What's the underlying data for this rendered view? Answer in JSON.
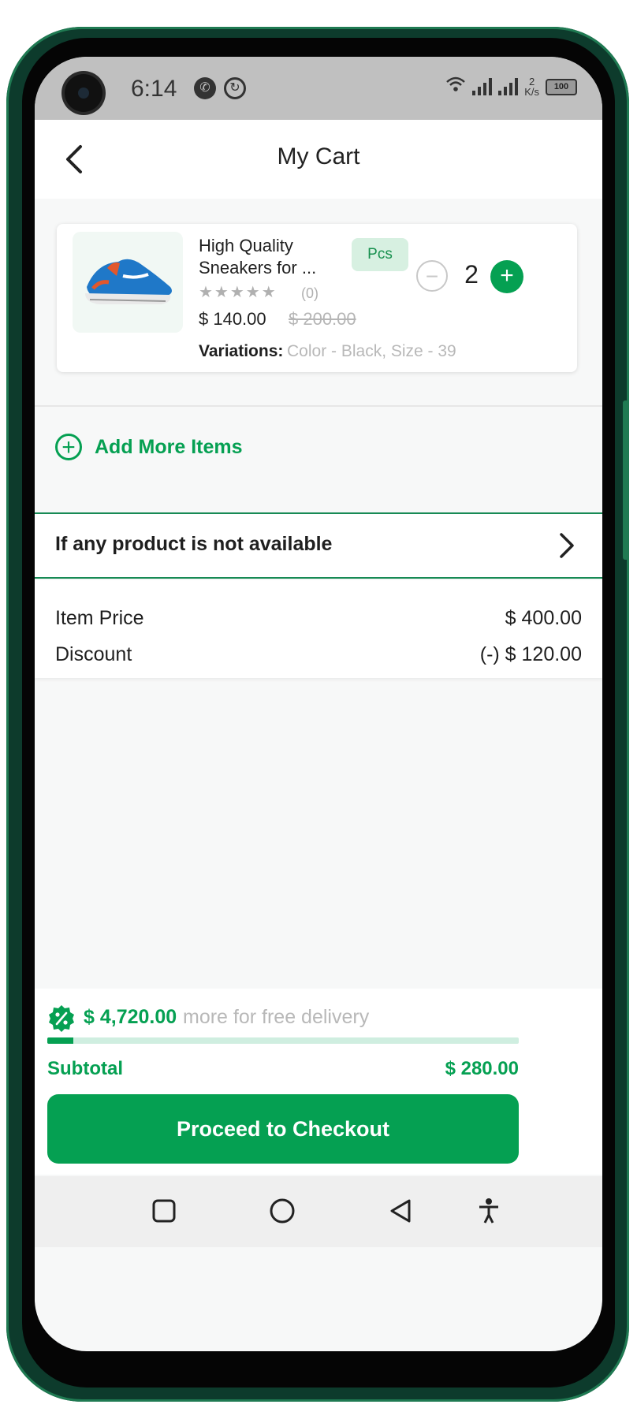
{
  "status_bar": {
    "time": "6:14",
    "icons": [
      "whatsapp-icon",
      "sync-icon",
      "wifi-icon",
      "signal-icon",
      "signal-icon"
    ],
    "net_speed_value": "2",
    "net_speed_unit": "K/s",
    "battery": "100"
  },
  "header": {
    "title": "My Cart",
    "back_icon": "chevron-left-icon"
  },
  "cart_item": {
    "name": "High Quality Sneakers for ...",
    "rating_stars": "★★★★★",
    "rating_count": "(0)",
    "price": "$ 140.00",
    "original_price": "$ 200.00",
    "unit": "Pcs",
    "quantity": "2",
    "variations_label": "Variations:",
    "variations_value": "Color - Black,  Size - 39"
  },
  "add_more": {
    "label": "Add More Items",
    "icon": "plus-circle-icon"
  },
  "availability": {
    "label": "If any product is not available",
    "icon": "chevron-right-icon"
  },
  "summary": {
    "item_price_label": "Item Price",
    "item_price_value": "$ 400.00",
    "discount_label": "Discount",
    "discount_value": "(-) $ 120.00"
  },
  "bottom": {
    "promo_amount": "$ 4,720.00",
    "promo_text": "more for free delivery",
    "progress_fraction": 0.056,
    "subtotal_label": "Subtotal",
    "subtotal_value": "$ 280.00",
    "checkout_label": "Proceed to Checkout"
  },
  "colors": {
    "primary": "#05a052",
    "primary_light": "#d7f0e1",
    "frame": "#0d3b2c"
  }
}
